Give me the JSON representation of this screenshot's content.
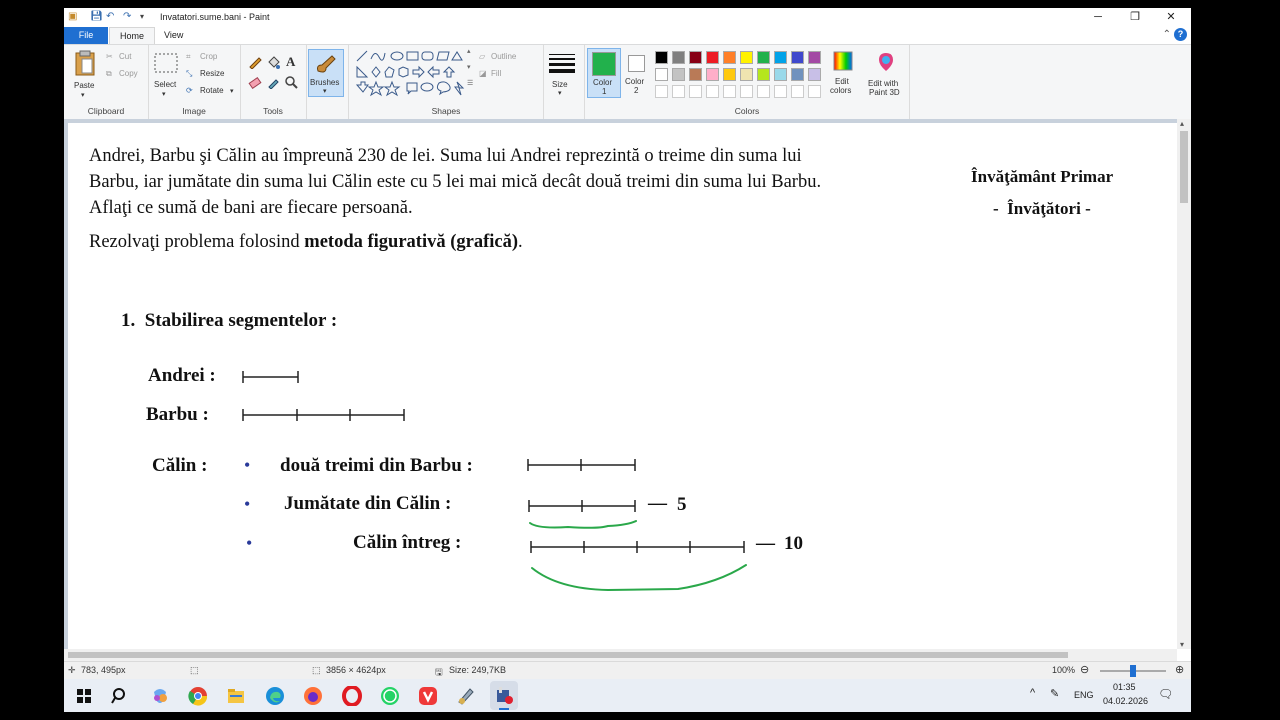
{
  "window": {
    "title": "Invatatori.sume.bani - Paint",
    "buttons": {
      "minimize": "─",
      "maximize": "❐",
      "close": "✕"
    }
  },
  "menu": {
    "file": "File",
    "tabs": [
      "Home",
      "View"
    ]
  },
  "ribbon": {
    "clipboard": {
      "paste": "Paste",
      "cut": "Cut",
      "copy": "Copy",
      "label": "Clipboard"
    },
    "image": {
      "select": "Select",
      "crop": "Crop",
      "resize": "Resize",
      "rotate": "Rotate",
      "label": "Image"
    },
    "tools": {
      "label": "Tools"
    },
    "brushes": {
      "label": "Brushes"
    },
    "shapes": {
      "outline": "Outline",
      "fill": "Fill",
      "label": "Shapes"
    },
    "size": {
      "label": "Size"
    },
    "colors": {
      "color1": "Color\n1",
      "color2": "Color\n2",
      "color1_label_a": "Color",
      "color1_label_b": "1",
      "color2_label_a": "Color",
      "color2_label_b": "2",
      "edit_colors_a": "Edit",
      "edit_colors_b": "colors",
      "label": "Colors",
      "color1_value": "#22b14c",
      "color2_value": "#ffffff",
      "palette_row1": [
        "#000000",
        "#7f7f7f",
        "#880015",
        "#ed1c24",
        "#ff7f27",
        "#fff200",
        "#22b14c",
        "#00a2e8",
        "#3f48cc",
        "#a349a4"
      ],
      "palette_row2": [
        "#ffffff",
        "#c3c3c3",
        "#b97a57",
        "#ffaec9",
        "#ffc90e",
        "#efe4b0",
        "#b5e61d",
        "#99d9ea",
        "#7092be",
        "#c8bfe7"
      ]
    },
    "paint3d": {
      "line1": "Edit with",
      "line2": "Paint 3D"
    }
  },
  "document": {
    "problem_line1": "Andrei, Barbu şi Călin au împreună 230 de lei. Suma lui Andrei reprezintă o treime din suma lui",
    "problem_line2": "Barbu, iar jumătate din suma lui Călin este cu 5 lei mai mică decât două treimi din suma lui Barbu.",
    "problem_line3": "Aflaţi ce sumă de bani are fiecare persoană.",
    "method_prefix": "Rezolvaţi problema folosind ",
    "method_bold": "metoda figurativă (grafică)",
    "method_suffix": ".",
    "brand_line1": "Învăţământ Primar",
    "brand_line2": "-  Învăţători -",
    "step_title": "1.  Stabilirea segmentelor :",
    "andrei_label": "Andrei :",
    "barbu_label": "Barbu :",
    "calin_label": "Călin :",
    "bullet": "•",
    "calin_item1": "două treimi din Barbu :",
    "calin_item2": "Jumătate din Călin :",
    "calin_item3": "Călin întreg :",
    "minus": "—",
    "value_5": "5",
    "value_10": "10"
  },
  "statusbar": {
    "cursor": "783, 495px",
    "dimensions": "3856 × 4624px",
    "size": "Size: 249,7KB",
    "zoom": "100%",
    "zoom_level": 0.5
  },
  "taskbar": {
    "lang": "ENG",
    "time": "01:35",
    "date": "04.02.2026"
  }
}
